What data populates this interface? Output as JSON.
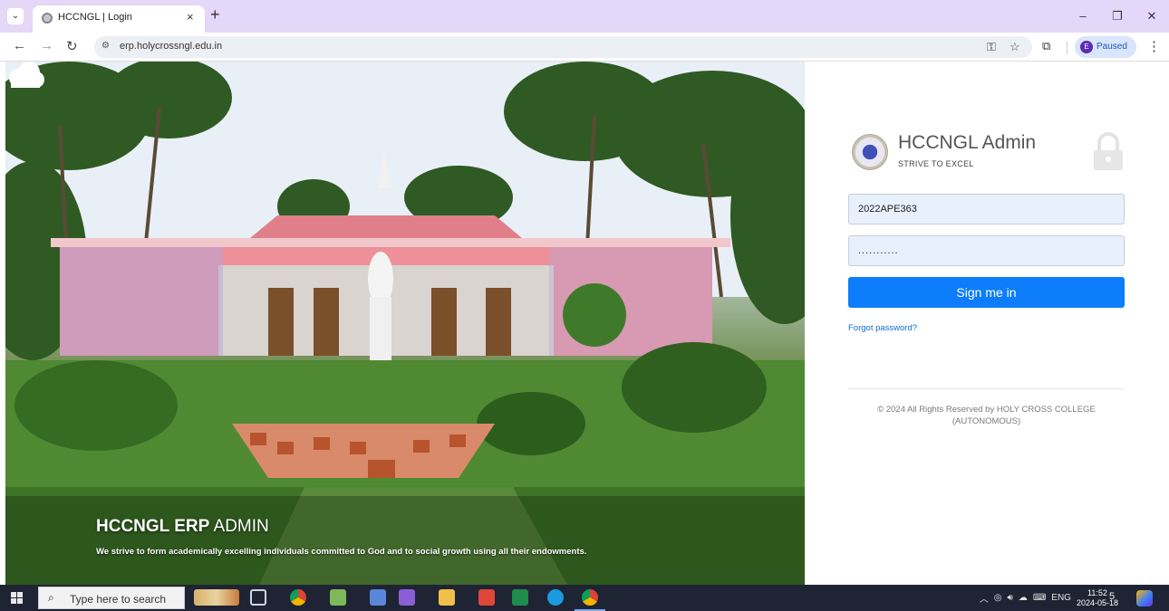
{
  "browser": {
    "tab_title": "HCCNGL | Login",
    "tab_close": "×",
    "new_tab": "+",
    "url": "erp.holycrossngl.edu.in",
    "profile_initial": "E",
    "profile_status": "Paused",
    "window_controls": [
      "–",
      "❐",
      "✕"
    ]
  },
  "hero": {
    "title_bold": "HCCNGL ERP",
    "title_light": "ADMIN",
    "subtitle": "We strive to form academically excelling individuals committed to God and to social growth using all their endowments."
  },
  "login": {
    "brand_title": "HCCNGL Admin",
    "brand_tagline": "STRIVE TO EXCEL",
    "username_value": "2022APE363",
    "password_value": "...........",
    "signin_label": "Sign me in",
    "forgot_label": "Forgot password?",
    "copyright": "© 2024 All Rights Reserved by HOLY CROSS COLLEGE (AUTONOMOUS)"
  },
  "taskbar": {
    "search_placeholder": "Type here to search",
    "language": "ENG",
    "time": "11:52",
    "date": "2024-05-18",
    "notification_count": "5",
    "apps": [
      {
        "name": "task-view-icon",
        "color": "#cfd6e0"
      },
      {
        "name": "chrome-icon",
        "color": "#f4b400"
      },
      {
        "name": "notepad-icon",
        "color": "#7fb85a"
      },
      {
        "name": "snipping-tool-icon",
        "color": "#5a86d9"
      },
      {
        "name": "visual-studio-icon",
        "color": "#8a5fd6"
      },
      {
        "name": "file-explorer-icon",
        "color": "#f0c04a"
      },
      {
        "name": "anydesk-icon",
        "color": "#e0453a"
      },
      {
        "name": "excel-icon",
        "color": "#1f8b4c"
      },
      {
        "name": "skype-icon",
        "color": "#1a9be0"
      },
      {
        "name": "chrome-profile-icon",
        "color": "#e8553b"
      }
    ]
  },
  "colors": {
    "tab_bar": "#e5d7f7",
    "signin_button": "#0d7dfb",
    "input_fill": "#e8f0fe",
    "link": "#1266d6",
    "taskbar": "#1e2433"
  }
}
